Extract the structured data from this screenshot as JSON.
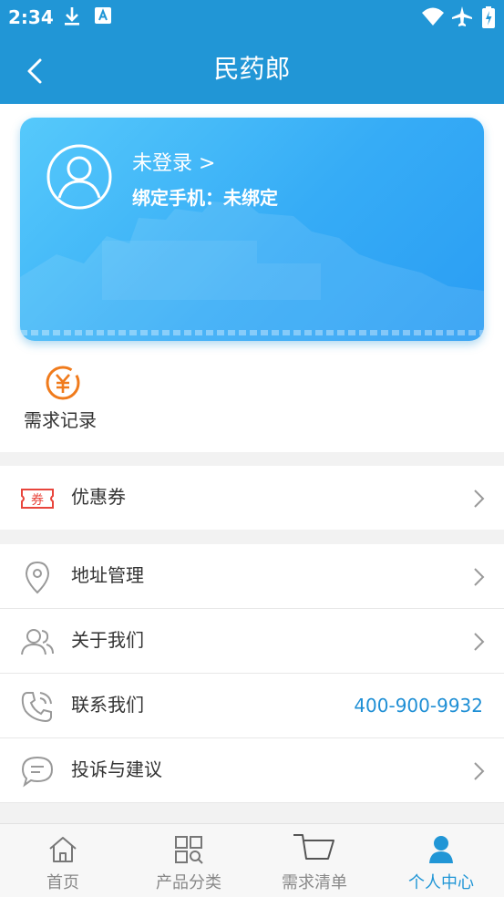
{
  "status_bar": {
    "time": "2:34",
    "icons": [
      "download-icon",
      "a-badge-icon",
      "wifi-icon",
      "airplane-icon",
      "battery-icon"
    ]
  },
  "header": {
    "title": "民药郎",
    "back_icon": "back-arrow-icon"
  },
  "profile": {
    "login_status": "未登录 >",
    "phone_label": "绑定手机：未绑定",
    "avatar_icon": "avatar-icon"
  },
  "quick_actions": [
    {
      "label": "需求记录",
      "icon": "yuan-coin-icon"
    }
  ],
  "menu": {
    "coupon": {
      "label": "优惠券",
      "icon": "coupon-icon",
      "badge": "券"
    },
    "address": {
      "label": "地址管理",
      "icon": "location-pin-icon"
    },
    "about": {
      "label": "关于我们",
      "icon": "people-icon"
    },
    "contact": {
      "label": "联系我们",
      "icon": "phone-icon",
      "value": "400-900-9932"
    },
    "feedback": {
      "label": "投诉与建议",
      "icon": "chat-bubble-icon"
    }
  },
  "bottom_nav": [
    {
      "label": "首页",
      "icon": "home-icon",
      "active": false
    },
    {
      "label": "产品分类",
      "icon": "category-grid-icon",
      "active": false
    },
    {
      "label": "需求清单",
      "icon": "cart-icon",
      "active": false
    },
    {
      "label": "个人中心",
      "icon": "person-icon",
      "active": true
    }
  ],
  "colors": {
    "primary": "#2196d6",
    "card_gradient_start": "#56c9fb",
    "card_gradient_end": "#2a9df3",
    "accent_orange": "#f07b1c",
    "coupon_red": "#e8453c",
    "link_blue": "#1f8fd5"
  }
}
